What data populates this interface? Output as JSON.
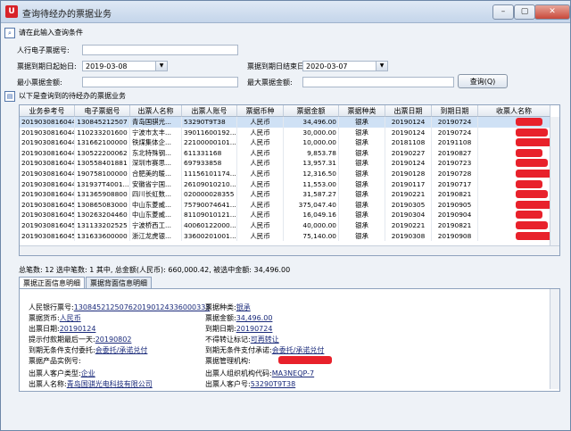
{
  "window": {
    "title": "查询待经办的票据业务",
    "buttons": [
      "–",
      "▢",
      "✕"
    ]
  },
  "query": {
    "header": "请在此输入查询条件",
    "bill_no_label": "人行电子票据号:",
    "due_start_label": "票据到期日起始日:",
    "due_start_value": "2019-03-08",
    "due_end_label": "票据到期日结束日:",
    "due_end_value": "2020-03-07",
    "min_amount_label": "最小票据金额:",
    "max_amount_label": "最大票据金额:",
    "search_button": "查询(Q)"
  },
  "results_header": "以下是查询到的待经办的票据业务",
  "table": {
    "columns": [
      "业务参考号",
      "电子票据号",
      "出票人名称",
      "出票人账号",
      "票据币种",
      "票据金额",
      "票据种类",
      "出票日期",
      "到期日期",
      "收票人名称"
    ],
    "rows": [
      [
        "20190308160442",
        "130845212507",
        "青岛国骐光...",
        "53290T9T38",
        "人民币",
        "34,496.00",
        "银承",
        "20190124",
        "20190724",
        ""
      ],
      [
        "20190308160443",
        "110233201600",
        "宁波市太丰...",
        "39011600192...",
        "人民币",
        "30,000.00",
        "银承",
        "20190124",
        "20190724",
        ""
      ],
      [
        "20190308160444",
        "131662100000",
        "铁煤集体企...",
        "22100000101...",
        "人民币",
        "10,000.00",
        "银承",
        "20181108",
        "20191108",
        ""
      ],
      [
        "20190308160445",
        "130522200062",
        "东北特殊钢...",
        "611331168",
        "人民币",
        "9,853.78",
        "银承",
        "20190227",
        "20190827",
        ""
      ],
      [
        "20190308160446",
        "130558401881",
        "深圳市赛思...",
        "697933858",
        "人民币",
        "13,957.31",
        "银承",
        "20190124",
        "20190723",
        ""
      ],
      [
        "20190308160447",
        "190758100000",
        "合肥美的暖...",
        "11156101174...",
        "人民币",
        "12,316.50",
        "银承",
        "20190128",
        "20190728",
        ""
      ],
      [
        "20190308160448",
        "131937T4001...",
        "安徽省宁国...",
        "26109010210...",
        "人民币",
        "11,553.00",
        "银承",
        "20190117",
        "20190717",
        ""
      ],
      [
        "20190308160449",
        "131365908800",
        "四川长虹数...",
        "020000028355",
        "人民币",
        "31,587.27",
        "银承",
        "20190221",
        "20190821",
        ""
      ],
      [
        "20190308160450",
        "130865083000",
        "中山东菱威...",
        "75790074641...",
        "人民币",
        "375,047.40",
        "银承",
        "20190305",
        "20190905",
        ""
      ],
      [
        "20190308160451",
        "130263204460",
        "中山东菱威...",
        "81109010121...",
        "人民币",
        "16,049.16",
        "银承",
        "20190304",
        "20190904",
        ""
      ],
      [
        "20190308160452",
        "131133202525",
        "宁波桥西工...",
        "40060122000...",
        "人民币",
        "40,000.00",
        "银承",
        "20190221",
        "20190821",
        ""
      ],
      [
        "20190308160453",
        "131633600000",
        "浙江龙虎银...",
        "33600201001...",
        "人民币",
        "75,140.00",
        "银承",
        "20190308",
        "20190908",
        ""
      ]
    ]
  },
  "summary": "总笔数: 12  选中笔数: 1  其中, 总金额(人民币): 660,000.42, 被选中金额: 34,496.00",
  "tabs": [
    "票据正面信息明细",
    "票据背面信息明细"
  ],
  "detail": {
    "bill_no_label": "人民银行票号:",
    "bill_no": "130845212507620190124336000333",
    "bill_type_label": "票据种类:",
    "bill_type": "银承",
    "currency_label": "票据货币:",
    "currency": "人民币",
    "amount_label": "票据金额:",
    "amount": "34,496.00",
    "issue_label": "出票日期:",
    "issue": "20190124",
    "due_label": "到期日期:",
    "due": "20190724",
    "prompt_label": "提示付款期最后一天:",
    "prompt": "20190802",
    "transfer_label": "不得转让标记:",
    "transfer": "可再转让",
    "uncond_label": "到期无条件支付委托:",
    "uncond": "会委托/承诺兑付",
    "promise_label": "到期无条件支付承诺:",
    "promise": "会委托/承诺兑付",
    "product_label": "票据产品实例号:",
    "mgmt_label": "票据管理机构:",
    "mgmt": "",
    "drawer_type_label": "出票人客户类型:",
    "drawer_type": "企业",
    "org_code_label": "出票人组织机构代码:",
    "org_code": "MA3NEQP-7",
    "drawer_name_label": "出票人名称:",
    "drawer_name": "青岛国骐光电科技有限公司",
    "drawer_no_label": "出票人客户号:",
    "drawer_no": "53290T9T38"
  },
  "colors": {
    "redaction": "#e8212b",
    "selection": "#cfe1f5"
  }
}
